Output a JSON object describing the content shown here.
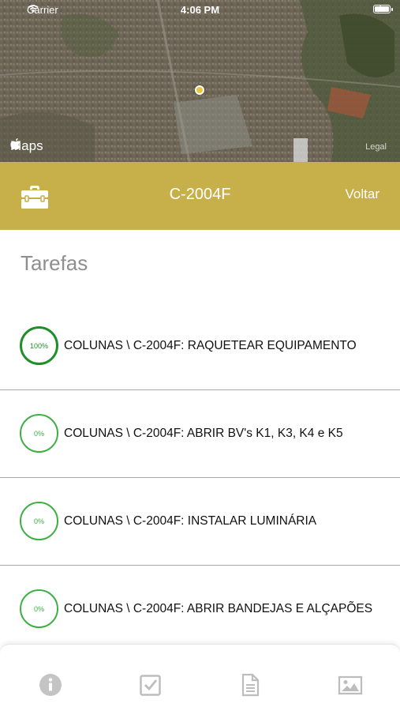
{
  "status_bar": {
    "carrier": "Carrier",
    "time": "4:06 PM"
  },
  "map": {
    "attribution": "Maps",
    "legal": "Legal"
  },
  "header": {
    "title": "C-2004F",
    "back_label": "Voltar",
    "background": "#c7b04a"
  },
  "section_title": "Tarefas",
  "tasks": [
    {
      "progress": "100%",
      "label": "COLUNAS \\ C-2004F: RAQUETEAR EQUIPAMENTO"
    },
    {
      "progress": "0%",
      "label": "COLUNAS \\ C-2004F: ABRIR BV's K1, K3, K4 e K5"
    },
    {
      "progress": "0%",
      "label": "COLUNAS \\ C-2004F: INSTALAR LUMINÁRIA"
    },
    {
      "progress": "0%",
      "label": "COLUNAS \\ C-2004F: ABRIR BANDEJAS E ALÇAPÕES"
    }
  ],
  "tabbar": {
    "icons": [
      "info-icon",
      "checkbox-icon",
      "document-icon",
      "image-icon"
    ]
  },
  "colors": {
    "accent": "#c7b04a",
    "progress_green": "#3cb043"
  }
}
